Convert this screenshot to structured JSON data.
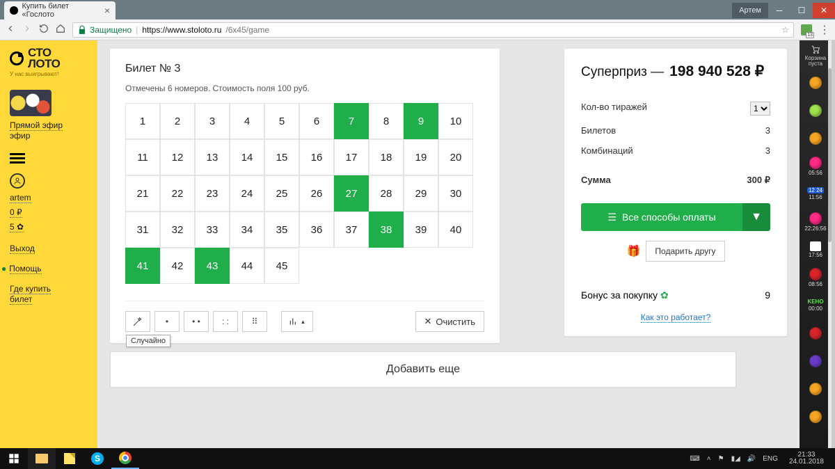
{
  "browser": {
    "tab_title": "Купить билет «Гослото",
    "user": "Артем",
    "secure_label": "Защищено",
    "url_host": "https://www.stoloto.ru",
    "url_path": "/6x45/game"
  },
  "sidebar_left": {
    "logo_top": "СТО",
    "logo_bottom": "ЛОТО",
    "tagline": "У нас выигрывают!",
    "live_label": "Прямой эфир",
    "user": "artem",
    "balance": "0 ₽",
    "bonus_count": "5",
    "logout": "Выход",
    "help": "Помощь",
    "where_top": "Где купить",
    "where_bot": "билет"
  },
  "ticket": {
    "title": "Билет № 3",
    "subtitle": "Отмечены 6 номеров. Стоимость поля 100 руб.",
    "max": 45,
    "selected": [
      7,
      9,
      27,
      38,
      41,
      43
    ],
    "wand_tip": "Случайно",
    "clear_label": "Очистить"
  },
  "summary": {
    "super_label": "Суперприз —",
    "super_amount": "198 940 528 ₽",
    "draws_label": "Кол-во тиражей",
    "draws_value": "1",
    "tickets_label": "Билетов",
    "tickets_value": "3",
    "combos_label": "Комбинаций",
    "combos_value": "3",
    "total_label": "Сумма",
    "total_value": "300 ₽",
    "pay_label": "Все способы оплаты",
    "gift_label": "Подарить другу",
    "bonus_label": "Бонус за покупку",
    "bonus_value": "9",
    "how_label": "Как это работает?"
  },
  "add_more": "Добавить еще",
  "rsb": {
    "cart_top": "Корзина",
    "cart_bot": "пуста",
    "items": [
      {
        "color": "orange",
        "t": ""
      },
      {
        "color": "green",
        "t": ""
      },
      {
        "color": "orange",
        "t": ""
      },
      {
        "color": "pink",
        "t": "05:56"
      },
      {
        "chip": "12 24",
        "t": "11:56"
      },
      {
        "color": "pink",
        "t": "22:26:56"
      },
      {
        "color": "",
        "t": "17:56",
        "shirt": true
      },
      {
        "color": "red",
        "t": "08:56"
      },
      {
        "color": "teal",
        "t": "00:00",
        "keno": true
      },
      {
        "color": "red",
        "t": ""
      },
      {
        "color": "purple",
        "t": ""
      },
      {
        "color": "orange",
        "t": ""
      },
      {
        "color": "orange",
        "t": ""
      }
    ]
  },
  "taskbar": {
    "lang": "ENG",
    "time": "21:33",
    "date": "24.01.2018"
  }
}
